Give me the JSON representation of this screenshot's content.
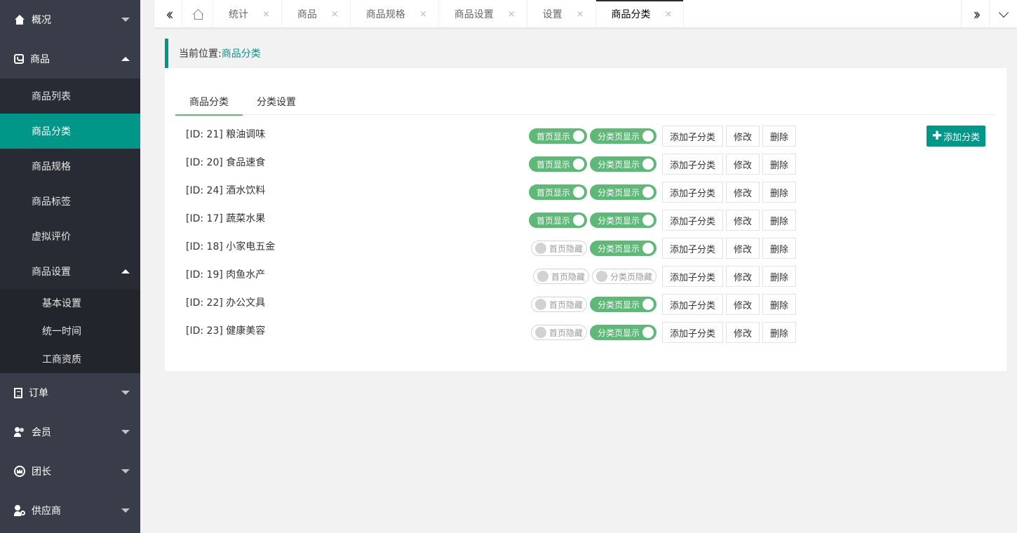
{
  "sidebar": {
    "menus": [
      {
        "label": "概况",
        "icon": "home-icon",
        "expanded": false
      },
      {
        "label": "商品",
        "icon": "shopping-bag-icon",
        "expanded": true
      },
      {
        "label": "订单",
        "icon": "document-icon",
        "expanded": false
      },
      {
        "label": "会员",
        "icon": "users-icon",
        "expanded": false
      },
      {
        "label": "团长",
        "icon": "crown-icon",
        "expanded": false
      },
      {
        "label": "供应商",
        "icon": "supplier-icon",
        "expanded": false
      }
    ],
    "goods_sub": [
      "商品列表",
      "商品分类",
      "商品规格",
      "商品标签",
      "虚拟评价",
      "商品设置"
    ],
    "goods_settings_sub": [
      "基本设置",
      "统一时间",
      "工商资质"
    ],
    "active_item": "商品分类"
  },
  "tabsbar": {
    "tabs": [
      "统计",
      "商品",
      "商品规格",
      "商品设置",
      "设置",
      "商品分类"
    ],
    "active": "商品分类",
    "close_glyph": "×"
  },
  "breadcrumb": {
    "label": "当前位置:",
    "current": "商品分类"
  },
  "subtabs": [
    "商品分类",
    "分类设置"
  ],
  "add_button": {
    "plus": "✚",
    "label": "添加分类"
  },
  "row_buttons": {
    "add_child": "添加子分类",
    "edit": "修改",
    "delete": "删除"
  },
  "switch_labels": {
    "home_on": "首页显示",
    "home_off": "首页隐藏",
    "cat_on": "分类页显示",
    "cat_off": "分类页隐藏"
  },
  "categories": [
    {
      "name": "[ID: 21] 粮油调味",
      "home_show": true,
      "cat_show": true
    },
    {
      "name": "[ID: 20] 食品速食",
      "home_show": true,
      "cat_show": true
    },
    {
      "name": "[ID: 24] 酒水饮料",
      "home_show": true,
      "cat_show": true
    },
    {
      "name": "[ID: 17] 蔬菜水果",
      "home_show": true,
      "cat_show": true
    },
    {
      "name": "[ID: 18] 小家电五金",
      "home_show": false,
      "cat_show": true
    },
    {
      "name": "[ID: 19] 肉鱼水产",
      "home_show": false,
      "cat_show": false
    },
    {
      "name": "[ID: 22] 办公文具",
      "home_show": false,
      "cat_show": true
    },
    {
      "name": "[ID: 23] 健康美容",
      "home_show": false,
      "cat_show": true
    }
  ],
  "colors": {
    "accent": "#009688",
    "switch_on": "#5fb878",
    "sidebar_bg": "#393d49"
  }
}
